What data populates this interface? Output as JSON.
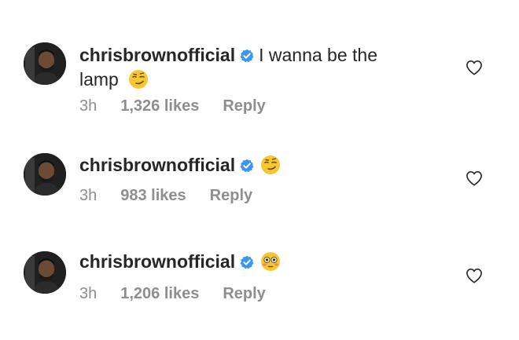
{
  "comments": [
    {
      "username": "chrisbrownofficial",
      "text": "I wanna be the lamp",
      "emoji": "smirking-face",
      "time": "3h",
      "likes": "1,326 likes",
      "reply": "Reply"
    },
    {
      "username": "chrisbrownofficial",
      "text": "",
      "emoji": "smirking-face",
      "time": "3h",
      "likes": "983 likes",
      "reply": "Reply"
    },
    {
      "username": "chrisbrownofficial",
      "text": "",
      "emoji": "flushed-face",
      "time": "3h",
      "likes": "1,206 likes",
      "reply": "Reply"
    }
  ],
  "colors": {
    "text": "#262626",
    "muted": "#8e8e8e",
    "verified": "#3897f0",
    "emoji": "#f7c633"
  }
}
